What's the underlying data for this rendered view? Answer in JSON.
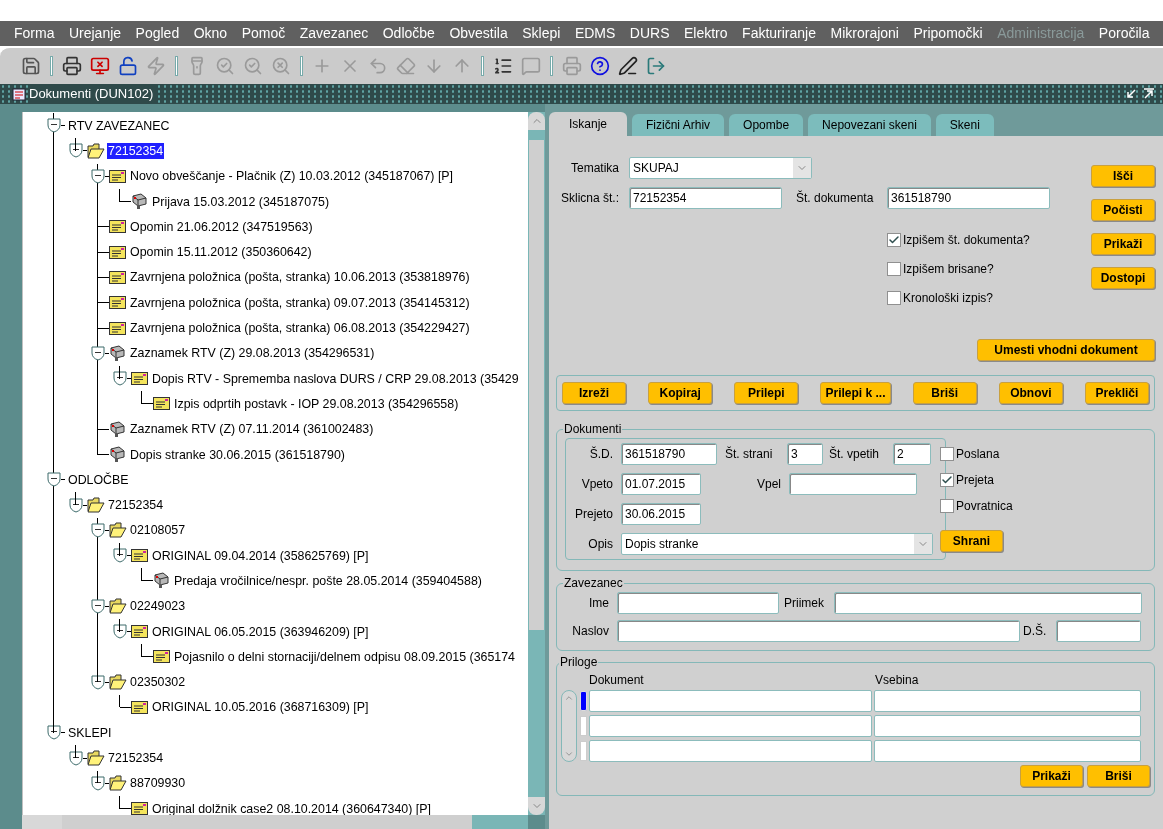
{
  "menu": [
    {
      "label": "Forma",
      "disabled": false
    },
    {
      "label": "Urejanje",
      "disabled": false
    },
    {
      "label": "Pogled",
      "disabled": false
    },
    {
      "label": "Okno",
      "disabled": false
    },
    {
      "label": "Pomoč",
      "disabled": false
    },
    {
      "label": "Zavezanec",
      "disabled": false
    },
    {
      "label": "Odločbe",
      "disabled": false
    },
    {
      "label": "Obvestila",
      "disabled": false
    },
    {
      "label": "Sklepi",
      "disabled": false
    },
    {
      "label": "EDMS",
      "disabled": false
    },
    {
      "label": "DURS",
      "disabled": false
    },
    {
      "label": "Elektro",
      "disabled": false
    },
    {
      "label": "Fakturiranje",
      "disabled": false
    },
    {
      "label": "Mikrorajoni",
      "disabled": false
    },
    {
      "label": "Pripomočki",
      "disabled": false
    },
    {
      "label": "Administracija",
      "disabled": true
    },
    {
      "label": "Poročila",
      "disabled": false
    }
  ],
  "toolbar": [
    {
      "kind": "save",
      "disabled": false
    },
    {
      "kind": "separator"
    },
    {
      "kind": "print",
      "disabled": false
    },
    {
      "kind": "monitor",
      "disabled": false
    },
    {
      "kind": "lock",
      "disabled": false
    },
    {
      "kind": "bolt",
      "disabled": true
    },
    {
      "kind": "separator"
    },
    {
      "kind": "flashlight",
      "disabled": true
    },
    {
      "kind": "query",
      "disabled": true
    },
    {
      "kind": "query",
      "disabled": true
    },
    {
      "kind": "cancel",
      "disabled": true
    },
    {
      "kind": "separator"
    },
    {
      "kind": "insert",
      "disabled": true
    },
    {
      "kind": "delete",
      "disabled": true
    },
    {
      "kind": "undo",
      "disabled": true
    },
    {
      "kind": "clear",
      "disabled": true
    },
    {
      "kind": "down",
      "disabled": true
    },
    {
      "kind": "up",
      "disabled": true
    },
    {
      "kind": "separator"
    },
    {
      "kind": "list",
      "disabled": false
    },
    {
      "kind": "comment",
      "disabled": true
    },
    {
      "kind": "separator"
    },
    {
      "kind": "print",
      "disabled": true
    },
    {
      "kind": "help",
      "disabled": false
    },
    {
      "kind": "edit",
      "disabled": false
    },
    {
      "kind": "exit",
      "disabled": false
    }
  ],
  "window": {
    "title": "Dokumenti (DUN102)"
  },
  "tree": [
    {
      "label": "RTV ZAVEZANEC",
      "kind": "group",
      "expanded": true,
      "selected": false,
      "children": [
        {
          "label": "72152354",
          "kind": "folder",
          "expanded": true,
          "selected": true,
          "children": [
            {
              "label": "Novo obveščanje - Plačnik (Z) 10.03.2012 (345187067) [P]",
              "kind": "letter",
              "expanded": true,
              "selected": false,
              "children": [
                {
                  "label": "Prijava 15.03.2012 (345187075)",
                  "kind": "stamp",
                  "selected": false
                }
              ]
            },
            {
              "label": "Opomin 21.06.2012 (347519563)",
              "kind": "letter",
              "selected": false
            },
            {
              "label": "Opomin 15.11.2012 (350360642)",
              "kind": "letter",
              "selected": false
            },
            {
              "label": "Zavrnjena položnica (pošta, stranka) 10.06.2013 (353818976)",
              "kind": "letter",
              "selected": false
            },
            {
              "label": "Zavrnjena položnica (pošta, stranka) 09.07.2013 (354145312)",
              "kind": "letter",
              "selected": false
            },
            {
              "label": "Zavrnjena položnica (pošta, stranka) 06.08.2013 (354229427)",
              "kind": "letter",
              "selected": false
            },
            {
              "label": "Zaznamek RTV (Z) 29.08.2013 (354296531)",
              "kind": "stamp",
              "expanded": true,
              "selected": false,
              "children": [
                {
                  "label": "Dopis RTV - Sprememba naslova DURS / CRP 29.08.2013 (35429",
                  "kind": "letter",
                  "expanded": true,
                  "selected": false,
                  "children": [
                    {
                      "label": "Izpis odprtih postavk - IOP 29.08.2013 (354296558)",
                      "kind": "letter",
                      "selected": false
                    }
                  ]
                }
              ]
            },
            {
              "label": "Zaznamek RTV (Z) 07.11.2014 (361002483)",
              "kind": "stamp",
              "selected": false
            },
            {
              "label": "Dopis stranke 30.06.2015 (361518790)",
              "kind": "stamp",
              "selected": false
            }
          ]
        }
      ]
    },
    {
      "label": "ODLOČBE",
      "kind": "group",
      "expanded": true,
      "selected": false,
      "children": [
        {
          "label": "72152354",
          "kind": "folder",
          "expanded": true,
          "selected": false,
          "children": [
            {
              "label": "02108057",
              "kind": "folder",
              "expanded": true,
              "selected": false,
              "children": [
                {
                  "label": "ORIGINAL 09.04.2014 (358625769) [P]",
                  "kind": "letter",
                  "expanded": true,
                  "selected": false,
                  "children": [
                    {
                      "label": "Predaja vročilnice/nespr. pošte 28.05.2014 (359404588)",
                      "kind": "stamp",
                      "selected": false
                    }
                  ]
                }
              ]
            },
            {
              "label": "02249023",
              "kind": "folder",
              "expanded": true,
              "selected": false,
              "children": [
                {
                  "label": "ORIGINAL 06.05.2015 (363946209) [P]",
                  "kind": "letter",
                  "expanded": true,
                  "selected": false,
                  "children": [
                    {
                      "label": "Pojasnilo o delni stornaciji/delnem odpisu 08.09.2015 (365174",
                      "kind": "letter",
                      "selected": false
                    }
                  ]
                }
              ]
            },
            {
              "label": "02350302",
              "kind": "folder",
              "expanded": true,
              "selected": false,
              "children": [
                {
                  "label": "ORIGINAL 10.05.2016 (368716309) [P]",
                  "kind": "letter",
                  "selected": false
                }
              ]
            }
          ]
        }
      ]
    },
    {
      "label": "SKLEPI",
      "kind": "group",
      "expanded": true,
      "selected": false,
      "children": [
        {
          "label": "72152354",
          "kind": "folder",
          "expanded": true,
          "selected": false,
          "children": [
            {
              "label": "88709930",
              "kind": "folder",
              "expanded": true,
              "selected": false,
              "children": [
                {
                  "label": "Original dolžnik case2 08.10.2014 (360647340) [P]",
                  "kind": "letter",
                  "selected": false
                }
              ]
            }
          ]
        }
      ]
    }
  ],
  "tabs": [
    {
      "label": "Iskanje",
      "selected": true
    },
    {
      "label": "Fizični Arhiv",
      "selected": false
    },
    {
      "label": "Opombe",
      "selected": false
    },
    {
      "label": "Nepovezani skeni",
      "selected": false
    },
    {
      "label": "Skeni",
      "selected": false
    }
  ],
  "search": {
    "tematika": {
      "label": "Tematika",
      "value": "SKUPAJ"
    },
    "sklicna": {
      "label": "Sklicna št.:",
      "value": "72152354"
    },
    "st_dokumenta": {
      "label": "Št. dokumenta",
      "value": "361518790"
    },
    "options": [
      {
        "label": "Izpišem št. dokumenta?",
        "checked": true
      },
      {
        "label": "Izpišem brisane?",
        "checked": false
      },
      {
        "label": "Kronološki izpis?",
        "checked": false
      }
    ],
    "side_buttons": [
      "Išči",
      "Počisti",
      "Prikaži",
      "Dostopi"
    ],
    "insert_button": "Umesti vhodni dokument"
  },
  "actions": [
    "Izreži",
    "Kopiraj",
    "Prilepi",
    "Prilepi k ...",
    "Briši",
    "Obnovi",
    "Prekliči"
  ],
  "dokumenti": {
    "title": "Dokumenti",
    "sd": {
      "label": "Š.D.",
      "value": "361518790"
    },
    "st_strani": {
      "label": "Št. strani",
      "value": "3"
    },
    "st_vpetih": {
      "label": "Št. vpetih",
      "value": "2"
    },
    "vpeto": {
      "label": "Vpeto",
      "value": "01.07.2015"
    },
    "vpel": {
      "label": "Vpel"
    },
    "prejeto": {
      "label": "Prejeto",
      "value": "30.06.2015"
    },
    "opis": {
      "label": "Opis",
      "value": "Dopis stranke"
    },
    "flags": [
      {
        "label": "Poslana",
        "checked": false
      },
      {
        "label": "Prejeta",
        "checked": true
      },
      {
        "label": "Povratnica",
        "checked": false
      }
    ],
    "save_button": "Shrani"
  },
  "zavezanec": {
    "title": "Zavezanec",
    "ime": {
      "label": "Ime"
    },
    "priimek": {
      "label": "Priimek"
    },
    "naslov": {
      "label": "Naslov"
    },
    "ds": {
      "label": "D.Š."
    }
  },
  "priloge": {
    "title": "Priloge",
    "columns": [
      "Dokument",
      "Vsebina"
    ],
    "rows": [
      {
        "selected": true
      },
      {
        "selected": false
      },
      {
        "selected": false
      }
    ],
    "buttons": [
      "Prikaži",
      "Briši"
    ]
  }
}
